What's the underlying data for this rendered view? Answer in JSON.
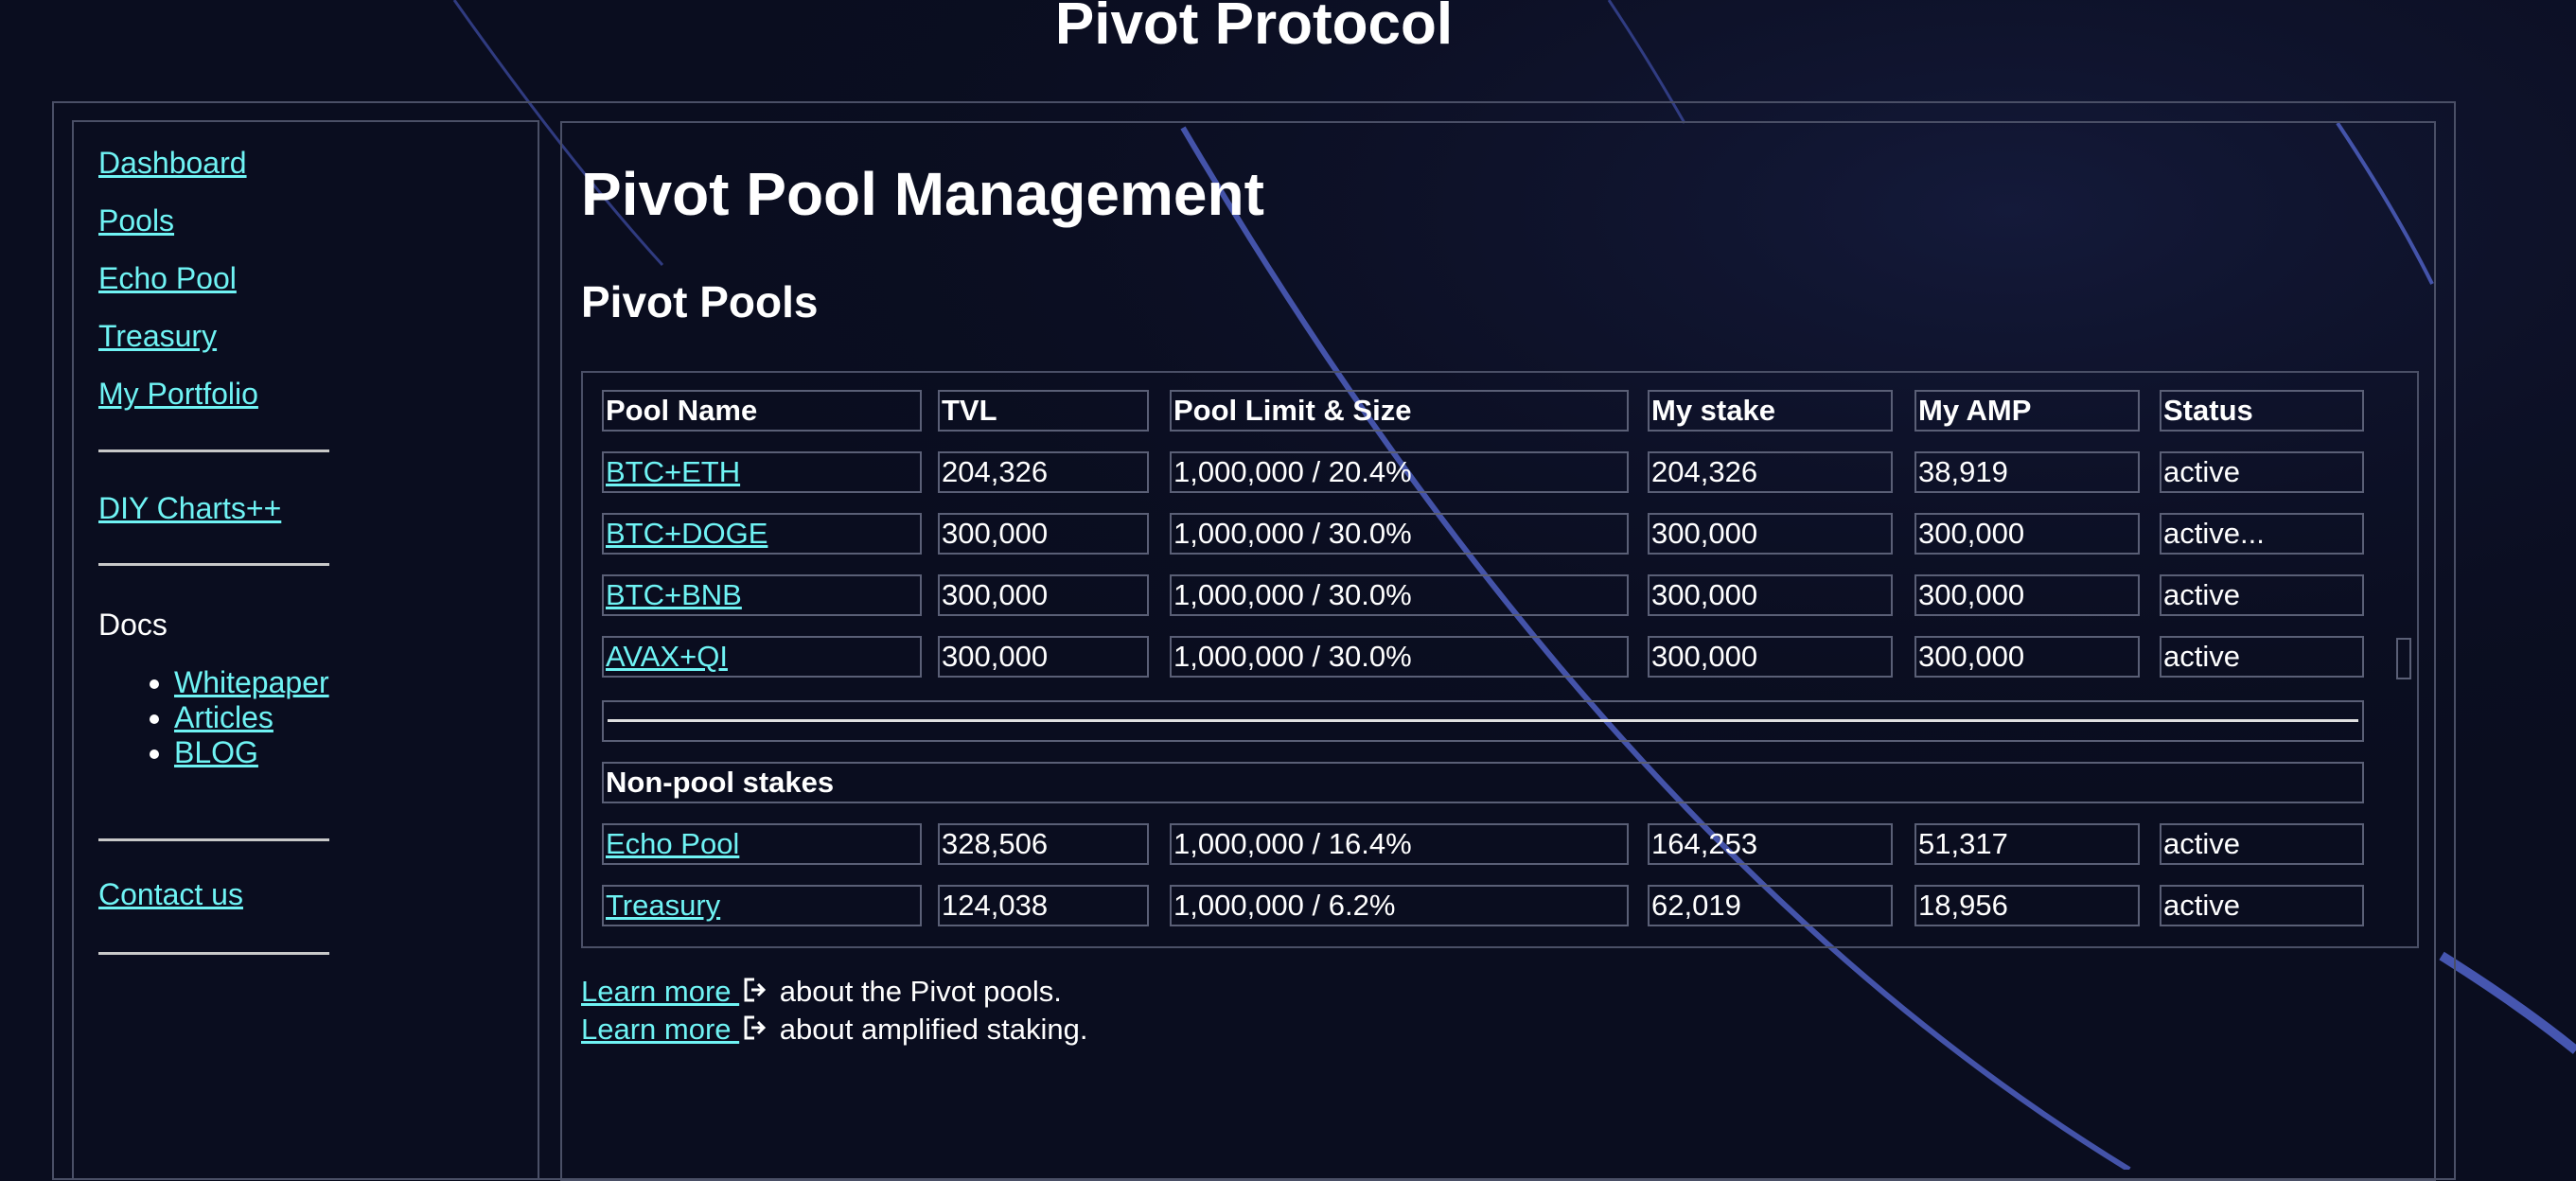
{
  "site": {
    "title": "Pivot Protocol"
  },
  "sidebar": {
    "nav": [
      {
        "label": "Dashboard"
      },
      {
        "label": "Pools"
      },
      {
        "label": "Echo Pool"
      },
      {
        "label": "Treasury"
      },
      {
        "label": "My Portfolio"
      }
    ],
    "diy": {
      "label": "DIY Charts++"
    },
    "docs": {
      "label": "Docs",
      "items": [
        {
          "label": "Whitepaper"
        },
        {
          "label": "Articles"
        },
        {
          "label": "BLOG"
        }
      ]
    },
    "contact": {
      "label": "Contact us"
    }
  },
  "main": {
    "heading": "Pivot Pool Management",
    "subheading": "Pivot Pools",
    "table": {
      "headers": [
        "Pool Name",
        "TVL",
        "Pool Limit & Size",
        "My stake",
        "My AMP",
        "Status"
      ],
      "pools": [
        {
          "name": "BTC+ETH",
          "tvl": "204,326",
          "limit": "1,000,000 / 20.4%",
          "stake": "204,326",
          "amp": "38,919",
          "status": "active"
        },
        {
          "name": "BTC+DOGE",
          "tvl": "300,000",
          "limit": "1,000,000 / 30.0%",
          "stake": "300,000",
          "amp": "300,000",
          "status": "active..."
        },
        {
          "name": "BTC+BNB",
          "tvl": "300,000",
          "limit": "1,000,000 / 30.0%",
          "stake": "300,000",
          "amp": "300,000",
          "status": "active"
        },
        {
          "name": "AVAX+QI",
          "tvl": "300,000",
          "limit": "1,000,000 / 30.0%",
          "stake": "300,000",
          "amp": "300,000",
          "status": "active"
        }
      ],
      "non_pool_label": "Non-pool stakes",
      "non_pool": [
        {
          "name": "Echo Pool",
          "tvl": "328,506",
          "limit": "1,000,000 / 16.4%",
          "stake": "164,253",
          "amp": "51,317",
          "status": "active"
        },
        {
          "name": "Treasury",
          "tvl": "124,038",
          "limit": "1,000,000 / 6.2%",
          "stake": "62,019",
          "amp": "18,956",
          "status": "active"
        }
      ]
    },
    "learn_more": [
      {
        "link": "Learn more ",
        "text": " about the Pivot pools."
      },
      {
        "link": "Learn more ",
        "text": " about amplified staking."
      }
    ]
  },
  "colors": {
    "background": "#0a0d1f",
    "link": "#6ff3f4",
    "accent_line": "#4a5bb8",
    "border": "#5a5f76"
  },
  "icons": {
    "external": "external-link-icon"
  }
}
